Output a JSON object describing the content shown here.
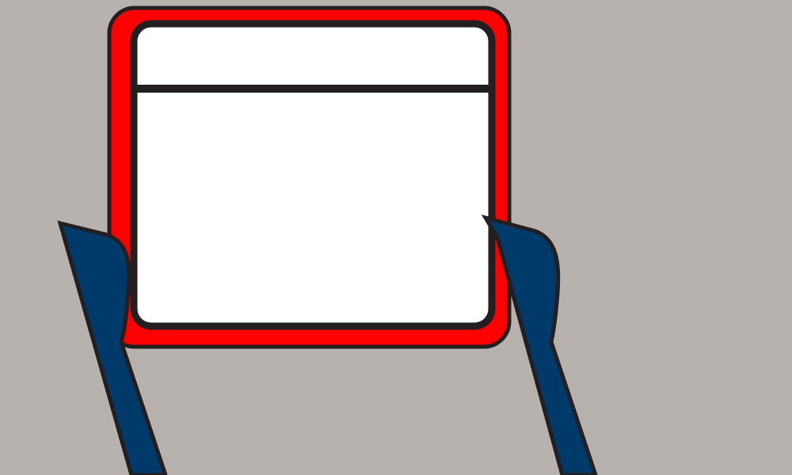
{
  "scene": {
    "description_icons": [
      "window-icon",
      "left-hand-icon",
      "right-hand-icon"
    ],
    "colors": {
      "background": "#b8b2ae",
      "frame": "#ff0000",
      "outline": "#231f20",
      "window_fill": "#ffffff",
      "hand": "#003a6b"
    }
  }
}
